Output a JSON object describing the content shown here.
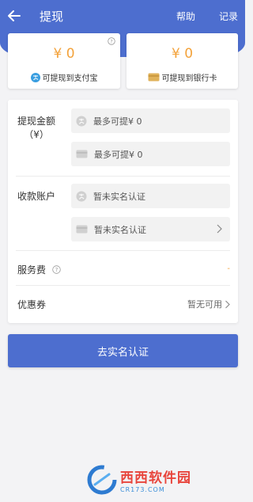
{
  "header": {
    "title": "提现",
    "help_label": "帮助",
    "record_label": "记录"
  },
  "cards": {
    "alipay": {
      "amount": "¥ 0",
      "label": "可提现到支付宝"
    },
    "bank": {
      "amount": "¥ 0",
      "label": "可提现到银行卡"
    }
  },
  "form": {
    "amount_label": "提现金额\n（¥）",
    "alipay_amount_placeholder": "最多可提¥ 0",
    "bank_amount_placeholder": "最多可提¥ 0",
    "account_label": "收款账户",
    "alipay_account_text": "暂未实名认证",
    "bank_account_text": "暂未实名认证",
    "fee_label": "服务费",
    "fee_value": "-",
    "coupon_label": "优惠券",
    "coupon_value": "暂无可用"
  },
  "submit_label": "去实名认证",
  "watermark": {
    "main": "西西软件园",
    "sub": "CR173.COM"
  },
  "colors": {
    "accent": "#4d6ecf",
    "amount": "#f3a23a",
    "alipay": "#3a9ee0",
    "bank": "#e0b25a"
  }
}
